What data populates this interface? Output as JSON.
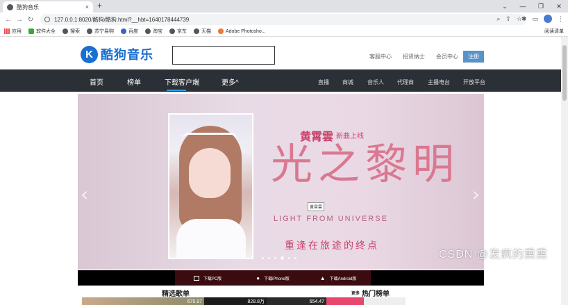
{
  "browser": {
    "tab_title": "酷狗音乐",
    "url": "127.0.0.1:8020/酷狗/酷狗.html?__hbt=1640178444739",
    "bookmarks": [
      {
        "label": "应用",
        "icon": "apps-icon"
      },
      {
        "label": "软件大全",
        "icon": "bookmark-icon"
      },
      {
        "label": "搜索",
        "icon": "bookmark-icon"
      },
      {
        "label": "苏宁易购",
        "icon": "bookmark-icon"
      },
      {
        "label": "百度",
        "icon": "baidu-icon"
      },
      {
        "label": "淘宝",
        "icon": "bookmark-icon"
      },
      {
        "label": "京东",
        "icon": "bookmark-icon"
      },
      {
        "label": "天猫",
        "icon": "bookmark-icon"
      },
      {
        "label": "Adobe Photosho...",
        "icon": "bookmark-icon"
      }
    ],
    "reading_list": "阅读清单"
  },
  "header": {
    "logo_letter": "K",
    "brand": "酷狗音乐",
    "search_placeholder": "",
    "links": [
      "客服中心",
      "招贤纳士",
      "会员中心"
    ],
    "register": "注册"
  },
  "nav": {
    "main": [
      "首页",
      "榜单",
      "下载客户端",
      "更多^"
    ],
    "sub": [
      "直播",
      "商城",
      "音乐人",
      "代理商",
      "主播电台",
      "开放平台"
    ]
  },
  "banner": {
    "artist": "黄霄雲",
    "artist_sub": "新曲上线",
    "title": "光之黎明",
    "title_en": "LIGHT FROM UNIVERSE",
    "slogan": "重逢在旅途的终点",
    "tooltip": "黄霄雲",
    "slides_total": 6,
    "slide_active": 3
  },
  "downloads": [
    "下载PC版",
    "下载iPhone版",
    "下载Android版"
  ],
  "sections": {
    "featured": "精选歌单",
    "more_label": "更多",
    "hot_chart": "热门榜单",
    "plays": [
      "675.97",
      "828.8万",
      "654.47"
    ]
  },
  "watermark": "CSDN @发疯的熏熏"
}
